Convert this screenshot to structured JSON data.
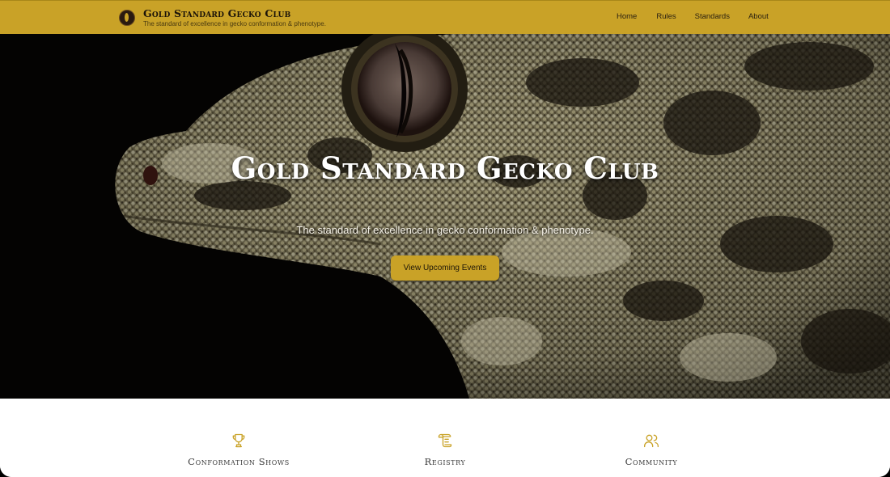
{
  "header": {
    "title": "Gold Standard Gecko Club",
    "tagline": "The standard of excellence in gecko conformation & phenotype.",
    "nav": [
      "Home",
      "Rules",
      "Standards",
      "About"
    ]
  },
  "hero": {
    "title": "Gold Standard Gecko Club",
    "subtitle": "The standard of excellence in gecko conformation & phenotype.",
    "cta_label": "View Upcoming Events"
  },
  "features": [
    {
      "label": "Conformation Shows",
      "icon": "trophy-icon"
    },
    {
      "label": "Registry",
      "icon": "scroll-icon"
    },
    {
      "label": "Community",
      "icon": "users-icon"
    }
  ],
  "colors": {
    "accent": "#c9a227",
    "hero_background": "#050403"
  }
}
